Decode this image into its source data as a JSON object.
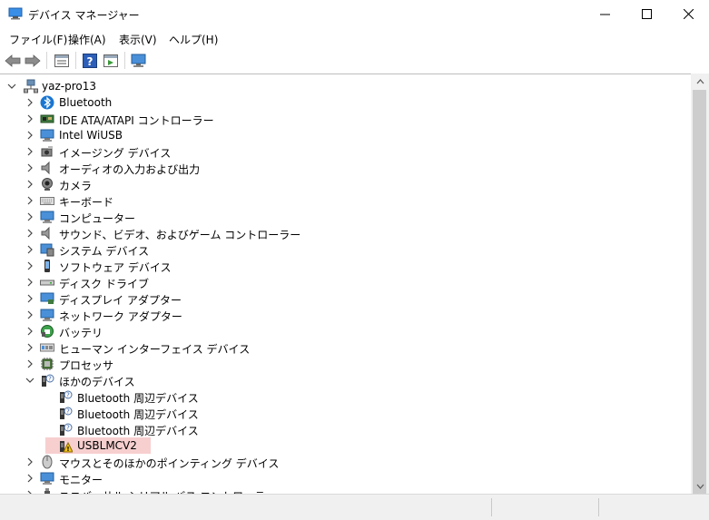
{
  "window": {
    "title": "デバイス マネージャー",
    "controls": [
      "minimize",
      "maximize",
      "close"
    ]
  },
  "menu": [
    {
      "label": "ファイル(F)"
    },
    {
      "label": "操作(A)"
    },
    {
      "label": "表示(V)"
    },
    {
      "label": "ヘルプ(H)"
    }
  ],
  "toolbar": {
    "buttons": [
      "back-arrow-icon",
      "forward-arrow-icon",
      "properties-icon",
      "help-icon",
      "update-driver-icon",
      "scan-monitor-icon"
    ]
  },
  "tree": {
    "root": {
      "label": "yaz-pro13",
      "icon": "computer-network-icon",
      "expanded": true
    },
    "items": [
      {
        "label": "Bluetooth",
        "icon": "bluetooth-icon"
      },
      {
        "label": "IDE ATA/ATAPI コントローラー",
        "icon": "ide-controller-icon"
      },
      {
        "label": "Intel WiUSB",
        "icon": "monitor-net-icon"
      },
      {
        "label": "イメージング デバイス",
        "icon": "imaging-icon"
      },
      {
        "label": "オーディオの入力および出力",
        "icon": "speaker-icon"
      },
      {
        "label": "カメラ",
        "icon": "camera-icon"
      },
      {
        "label": "キーボード",
        "icon": "keyboard-icon"
      },
      {
        "label": "コンピューター",
        "icon": "computer-icon"
      },
      {
        "label": "サウンド、ビデオ、およびゲーム コントローラー",
        "icon": "speaker-icon"
      },
      {
        "label": "システム デバイス",
        "icon": "system-icon"
      },
      {
        "label": "ソフトウェア デバイス",
        "icon": "software-icon"
      },
      {
        "label": "ディスク ドライブ",
        "icon": "disk-icon"
      },
      {
        "label": "ディスプレイ アダプター",
        "icon": "display-adapter-icon"
      },
      {
        "label": "ネットワーク アダプター",
        "icon": "network-adapter-icon"
      },
      {
        "label": "バッテリ",
        "icon": "battery-icon"
      },
      {
        "label": "ヒューマン インターフェイス デバイス",
        "icon": "hid-icon"
      },
      {
        "label": "プロセッサ",
        "icon": "processor-icon"
      },
      {
        "label": "ほかのデバイス",
        "icon": "unknown-device-icon",
        "expanded": true
      },
      {
        "label": "Bluetooth 周辺デバイス",
        "icon": "unknown-device-icon",
        "child": true
      },
      {
        "label": "Bluetooth 周辺デバイス",
        "icon": "unknown-device-icon",
        "child": true
      },
      {
        "label": "Bluetooth 周辺デバイス",
        "icon": "unknown-device-icon",
        "child": true
      },
      {
        "label": "USBLMCV2",
        "icon": "warning-device-icon",
        "child": true,
        "selected": true
      },
      {
        "label": "マウスとそのほかのポインティング デバイス",
        "icon": "mouse-icon"
      },
      {
        "label": "モニター",
        "icon": "monitor-icon"
      },
      {
        "label": "ユニバーサル シリアル バス コントローラー",
        "icon": "usb-icon"
      }
    ]
  },
  "colors": {
    "selection": "#f7cfcf",
    "status_bg": "#f0f0f0",
    "scroll_thumb": "#cdcdcd"
  }
}
